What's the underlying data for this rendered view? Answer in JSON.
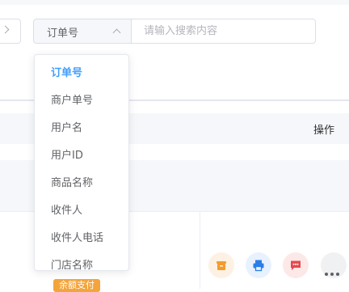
{
  "search": {
    "field_select": {
      "value": "订单号"
    },
    "input": {
      "placeholder": "请输入搜索内容"
    },
    "dropdown_options": [
      "订单号",
      "商户单号",
      "用户名",
      "用户ID",
      "商品名称",
      "收件人",
      "收件人电话",
      "门店名称"
    ],
    "selected_index": 0
  },
  "table": {
    "header": {
      "operations_label": "操作"
    },
    "row": {
      "payment_badge": "余额支付",
      "actions": [
        "box-icon",
        "printer-icon",
        "message-icon",
        "more-icon"
      ]
    }
  },
  "colors": {
    "accent": "#409eff",
    "badge": "#f3a43b",
    "action_orange": "#f39c2a",
    "action_blue": "#2b7de9",
    "action_red": "#e5484d"
  }
}
